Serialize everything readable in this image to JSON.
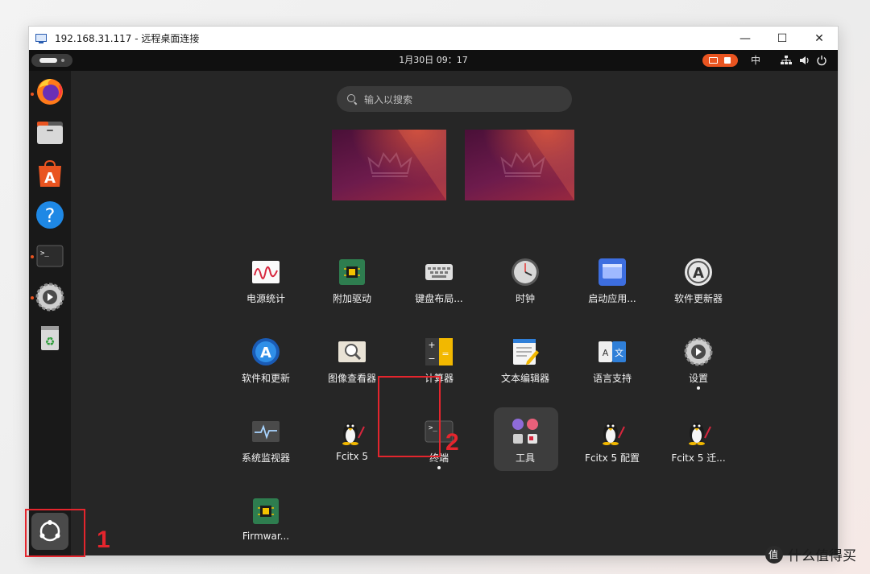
{
  "window": {
    "title": "192.168.31.117 - 远程桌面连接",
    "controls": {
      "minimize": "—",
      "maximize": "☐",
      "close": "✕"
    }
  },
  "topbar": {
    "datetime": "1月30日  09：17",
    "input_method": "中",
    "tray_icons": [
      "network-icon",
      "volume-icon",
      "power-icon"
    ]
  },
  "dock": {
    "items": [
      {
        "name": "firefox-icon",
        "running": true
      },
      {
        "name": "files-icon",
        "running": false
      },
      {
        "name": "app-center-icon",
        "running": false
      },
      {
        "name": "help-icon",
        "running": false
      },
      {
        "name": "terminal-icon",
        "running": true
      },
      {
        "name": "settings-icon",
        "running": true
      },
      {
        "name": "trash-icon",
        "running": false
      }
    ],
    "show_apps": "show-apps-icon"
  },
  "search": {
    "placeholder": "输入以搜索"
  },
  "apps": {
    "power_stats": "电源统计",
    "extra_drivers": "附加驱动",
    "keyboard_layout": "键盘布局...",
    "clock": "时钟",
    "startup_apps": "启动应用...",
    "software_updater": "软件更新器",
    "software_updates": "软件和更新",
    "image_viewer": "图像查看器",
    "calculator": "计算器",
    "text_editor": "文本编辑器",
    "language_support": "语言支持",
    "settings": "设置",
    "system_monitor": "系统监视器",
    "fcitx5": "Fcitx 5",
    "terminal": "终端",
    "utilities": "工具",
    "fcitx5_config": "Fcitx 5 配置",
    "fcitx5_migrate": "Fcitx 5 迁...",
    "firmware": "Firmwar..."
  },
  "annotations": {
    "step1": "1",
    "step2": "2"
  },
  "watermark": "什么值得买",
  "colors": {
    "accent": "#e95420",
    "annotation": "#e4252d"
  }
}
